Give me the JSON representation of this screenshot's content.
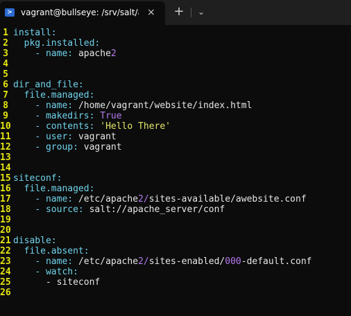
{
  "window": {
    "tab_title": "vagrant@bullseye: /srv/salt/a",
    "tab_icon": "powershell-icon",
    "close_glyph": "×",
    "new_tab_glyph": "+",
    "dropdown_glyph": "⌄"
  },
  "colors": {
    "background": "#0c0c0c",
    "line_number": "#e5e510",
    "key": "#6fd3ec",
    "number": "#b57bf0",
    "string": "#e5e56a",
    "text": "#e6e6e6"
  },
  "editor": {
    "lines": [
      {
        "n": "1",
        "parts": [
          [
            "k1",
            "install:"
          ]
        ]
      },
      {
        "n": "2",
        "parts": [
          [
            "plain",
            "  "
          ],
          [
            "k2",
            "pkg.installed:"
          ]
        ]
      },
      {
        "n": "3",
        "parts": [
          [
            "plain",
            "    "
          ],
          [
            "dash",
            "- "
          ],
          [
            "k3",
            "name: "
          ],
          [
            "plain",
            "apache"
          ],
          [
            "num",
            "2"
          ]
        ]
      },
      {
        "n": "4",
        "parts": []
      },
      {
        "n": "5",
        "parts": []
      },
      {
        "n": "6",
        "parts": [
          [
            "k1",
            "dir_and_file:"
          ]
        ]
      },
      {
        "n": "7",
        "parts": [
          [
            "plain",
            "  "
          ],
          [
            "k2",
            "file.managed:"
          ]
        ]
      },
      {
        "n": "8",
        "parts": [
          [
            "plain",
            "    "
          ],
          [
            "dash",
            "- "
          ],
          [
            "k3",
            "name: "
          ],
          [
            "plain",
            "/home/vagrant/website/index.html"
          ]
        ]
      },
      {
        "n": "9",
        "parts": [
          [
            "plain",
            "    "
          ],
          [
            "dash",
            "- "
          ],
          [
            "k3",
            "makedirs: "
          ],
          [
            "bool",
            "True"
          ]
        ]
      },
      {
        "n": "10",
        "parts": [
          [
            "plain",
            "    "
          ],
          [
            "dash",
            "- "
          ],
          [
            "k3",
            "contents: "
          ],
          [
            "str",
            "'Hello There'"
          ]
        ]
      },
      {
        "n": "11",
        "parts": [
          [
            "plain",
            "    "
          ],
          [
            "dash",
            "- "
          ],
          [
            "k3",
            "user: "
          ],
          [
            "plain",
            "vagrant"
          ]
        ]
      },
      {
        "n": "12",
        "parts": [
          [
            "plain",
            "    "
          ],
          [
            "dash",
            "- "
          ],
          [
            "k3",
            "group: "
          ],
          [
            "plain",
            "vagrant"
          ]
        ]
      },
      {
        "n": "13",
        "parts": []
      },
      {
        "n": "14",
        "parts": []
      },
      {
        "n": "15",
        "parts": [
          [
            "k1",
            "siteconf:"
          ]
        ]
      },
      {
        "n": "16",
        "parts": [
          [
            "plain",
            "  "
          ],
          [
            "k2",
            "file.managed:"
          ]
        ]
      },
      {
        "n": "17",
        "parts": [
          [
            "plain",
            "    "
          ],
          [
            "dash",
            "- "
          ],
          [
            "k3",
            "name: "
          ],
          [
            "plain",
            "/etc/apache"
          ],
          [
            "num",
            "2/"
          ],
          [
            "plain",
            "sites-available/awebsite.conf"
          ]
        ]
      },
      {
        "n": "18",
        "parts": [
          [
            "plain",
            "    "
          ],
          [
            "dash",
            "- "
          ],
          [
            "k3",
            "source: "
          ],
          [
            "plain",
            "salt://apache_server/conf"
          ]
        ]
      },
      {
        "n": "19",
        "parts": []
      },
      {
        "n": "20",
        "parts": []
      },
      {
        "n": "21",
        "parts": [
          [
            "k1",
            "disable:"
          ]
        ]
      },
      {
        "n": "22",
        "parts": [
          [
            "plain",
            "  "
          ],
          [
            "k2",
            "file.absent:"
          ]
        ]
      },
      {
        "n": "23",
        "parts": [
          [
            "plain",
            "    "
          ],
          [
            "dash",
            "- "
          ],
          [
            "k3",
            "name: "
          ],
          [
            "plain",
            "/etc/apache"
          ],
          [
            "num",
            "2/"
          ],
          [
            "plain",
            "sites-enabled/"
          ],
          [
            "num",
            "000"
          ],
          [
            "plain",
            "-default.conf"
          ]
        ]
      },
      {
        "n": "24",
        "parts": [
          [
            "plain",
            "    "
          ],
          [
            "dash",
            "- "
          ],
          [
            "k3",
            "watch:"
          ]
        ]
      },
      {
        "n": "25",
        "parts": [
          [
            "plain",
            "      - siteconf"
          ]
        ]
      },
      {
        "n": "26",
        "parts": []
      }
    ]
  }
}
